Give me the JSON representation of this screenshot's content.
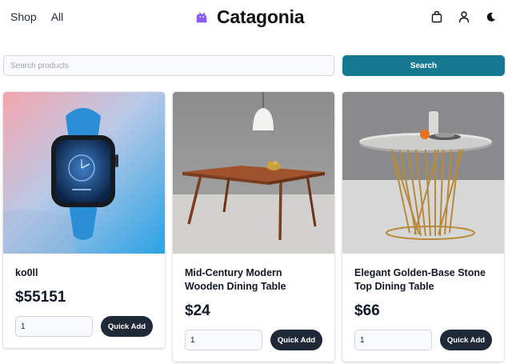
{
  "header": {
    "nav": [
      "Shop",
      "All"
    ],
    "brand_title": "Catagonia",
    "icons": [
      "cat-logo-icon",
      "shopping-bag-icon",
      "user-icon",
      "moon-icon"
    ]
  },
  "search": {
    "placeholder": "Search products",
    "button_label": "Search"
  },
  "colors": {
    "accent": "#167891",
    "button_dark": "#1f2937",
    "logo_purple": "#8b5cf6"
  },
  "products": [
    {
      "name": "ko0ll",
      "price": "$55151",
      "quantity": "1",
      "add_label": "Quick Add",
      "image": "smartwatch-photo"
    },
    {
      "name": "Mid-Century Modern Wooden Dining Table",
      "price": "$24",
      "quantity": "1",
      "add_label": "Quick Add",
      "image": "wooden-table-photo"
    },
    {
      "name": "Elegant Golden-Base Stone Top Dining Table",
      "price": "$66",
      "quantity": "1",
      "add_label": "Quick Add",
      "image": "round-table-photo"
    }
  ]
}
